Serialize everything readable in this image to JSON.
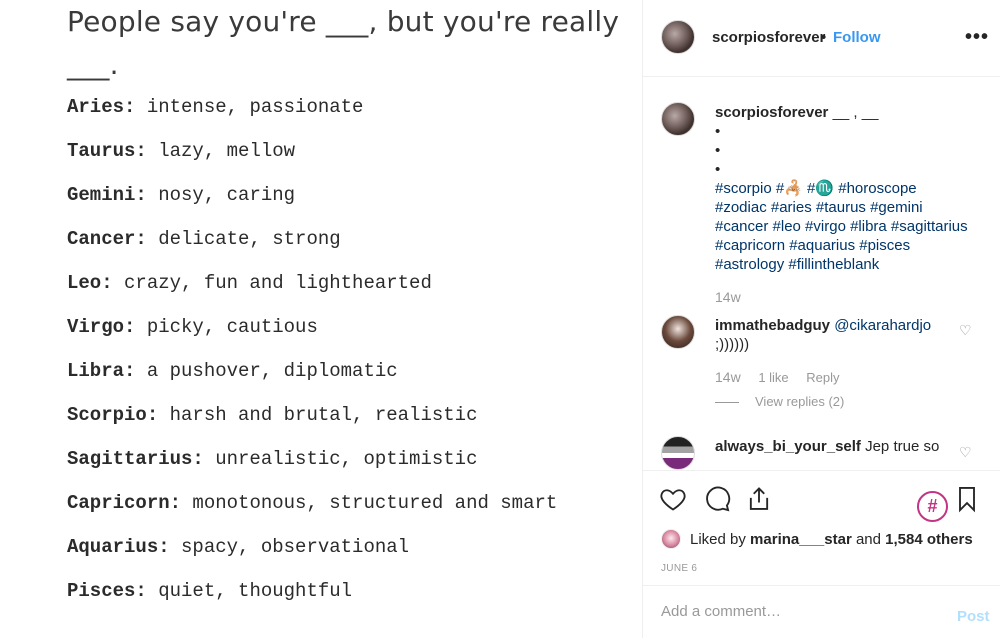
{
  "image": {
    "title": "People say you're ___, but you're really ___.",
    "signs": [
      {
        "name": "Aries:",
        "text": " intense, passionate"
      },
      {
        "name": "Taurus:",
        "text": " lazy, mellow"
      },
      {
        "name": "Gemini:",
        "text": " nosy, caring"
      },
      {
        "name": "Cancer:",
        "text": " delicate, strong"
      },
      {
        "name": "Leo:",
        "text": " crazy, fun and lighthearted"
      },
      {
        "name": "Virgo:",
        "text": " picky, cautious"
      },
      {
        "name": "Libra:",
        "text": " a pushover, diplomatic"
      },
      {
        "name": "Scorpio:",
        "text": " harsh and brutal, realistic"
      },
      {
        "name": "Sagittarius:",
        "text": " unrealistic, optimistic"
      },
      {
        "name": "Capricorn:",
        "text": " monotonous, structured and smart"
      },
      {
        "name": "Aquarius:",
        "text": " spacy, observational"
      },
      {
        "name": "Pisces:",
        "text": " quiet, thoughtful"
      }
    ]
  },
  "header": {
    "username": "scorpiosforever",
    "dot": "•",
    "follow_label": "Follow",
    "more_label": "•••"
  },
  "caption": {
    "username": "scorpiosforever",
    "text": "__ , __",
    "bullets": [
      "•",
      "•",
      "•"
    ],
    "hashtag_lines": [
      "#scorpio #🦂 #♏ #horoscope",
      "#zodiac #aries #taurus #gemini",
      "#cancer #leo #virgo #libra #sagittarius",
      "#capricorn #aquarius #pisces",
      "#astrology #fillintheblank"
    ],
    "time": "14w"
  },
  "comments": [
    {
      "username": "immathebadguy",
      "mention": "@cikarahardjo",
      "text": ";))))))",
      "time": "14w",
      "likes": "1 like",
      "reply_label": "Reply",
      "view_replies": "View replies (2)"
    },
    {
      "username": "always_bi_your_self",
      "text": "Jep true so"
    }
  ],
  "actions": {
    "hash_badge": "#",
    "liked_by_prefix": "Liked by ",
    "liked_by_user": "marina___star",
    "liked_by_and": " and ",
    "liked_by_count": "1,584 others",
    "date": "JUNE 6"
  },
  "add_comment": {
    "placeholder": "Add a comment…",
    "post_label": "Post"
  },
  "colors": {
    "link_blue": "#3897f0",
    "hashtag": "#003569",
    "muted": "#999999",
    "accent_magenta": "#c13584"
  }
}
